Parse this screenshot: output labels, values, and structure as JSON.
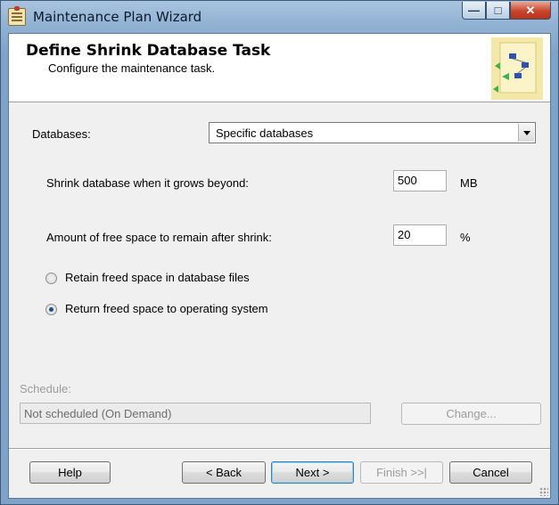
{
  "window": {
    "title": "Maintenance Plan Wizard",
    "minimize_glyph": "—",
    "maximize_glyph": "□",
    "close_glyph": "✕"
  },
  "header": {
    "title": "Define Shrink Database Task",
    "subtitle": "Configure the maintenance task."
  },
  "databases": {
    "label": "Databases:",
    "selected": "Specific databases"
  },
  "shrink": {
    "label": "Shrink database when it grows beyond:",
    "value": "500",
    "unit": "MB"
  },
  "free_space": {
    "label": "Amount of free space to remain after shrink:",
    "value": "20",
    "unit": "%"
  },
  "options": {
    "retain_label": "Retain freed space in database files",
    "retain_checked": false,
    "return_label": "Return freed space to operating system",
    "return_checked": true
  },
  "schedule": {
    "label": "Schedule:",
    "value": "Not scheduled (On Demand)",
    "change_label": "Change..."
  },
  "footer": {
    "help_label": "Help",
    "back_label": "< Back",
    "next_label": "Next >",
    "finish_label": "Finish >>|",
    "cancel_label": "Cancel"
  },
  "colors": {
    "frame": "#8fb0d2",
    "close_button": "#c9452c",
    "radio_dot": "#1d4f8a",
    "default_button_border": "#3c7fb1"
  }
}
